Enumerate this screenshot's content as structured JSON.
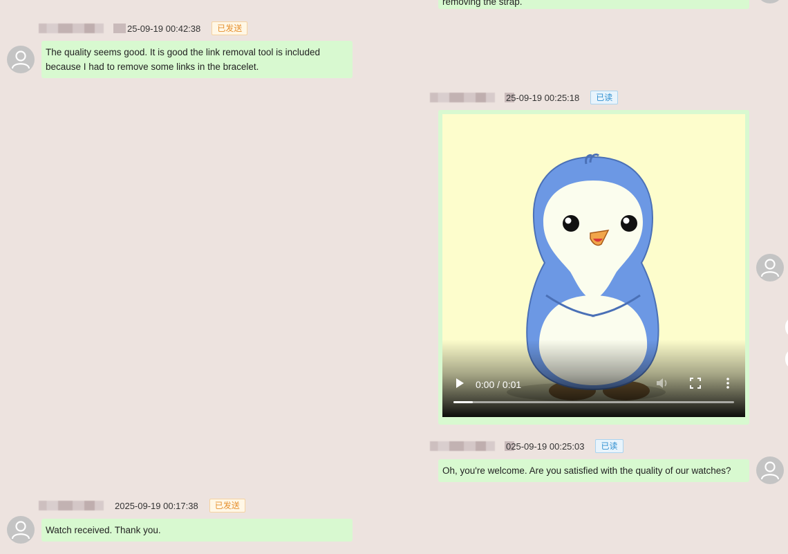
{
  "messages": [
    {
      "side": "right",
      "text": "removing the strap."
    },
    {
      "side": "left",
      "timestamp": "25-09-19 00:42:38",
      "status": "已发送",
      "text": "The quality seems good. It is good the link removal tool is included because I had to remove some links in the bracelet."
    },
    {
      "side": "right",
      "timestamp": "25-09-19 00:25:18",
      "status": "已读",
      "video": {
        "time": "0:00 / 0:01",
        "progress_fraction": 0.07
      }
    },
    {
      "side": "right",
      "timestamp": "025-09-19 00:25:03",
      "status": "已读",
      "text": "Oh, you're welcome. Are you satisfied with the quality of our watches?"
    },
    {
      "side": "left",
      "timestamp": "2025-09-19 00:17:38",
      "status": "已发送",
      "text": "Watch received. Thank you."
    }
  ],
  "icons": {
    "avatar": "user-icon",
    "play": "play-icon",
    "volume": "volume-icon",
    "fullscreen": "fullscreen-icon",
    "more": "more-vertical-icon"
  },
  "colors": {
    "background": "#ede3df",
    "bubble": "#d8f9d0",
    "sent_badge": "#e6902e",
    "read_badge": "#2f8fd0"
  }
}
